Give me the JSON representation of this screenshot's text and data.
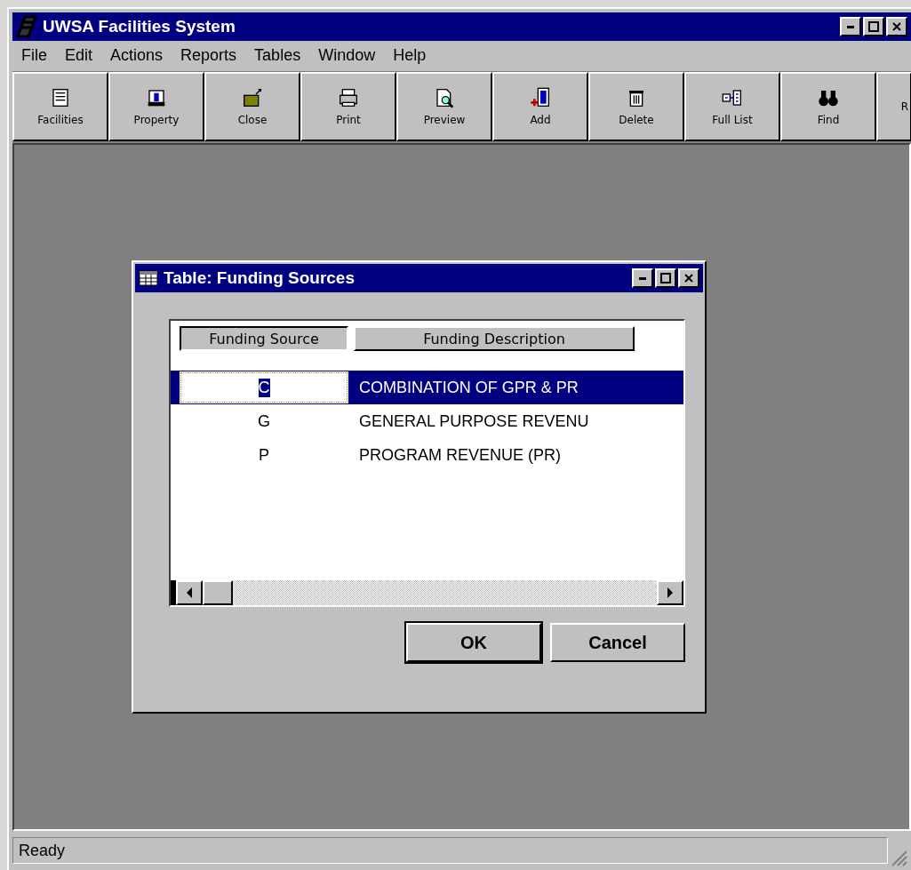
{
  "window": {
    "title": "UWSA Facilities System"
  },
  "menu": [
    "File",
    "Edit",
    "Actions",
    "Reports",
    "Tables",
    "Window",
    "Help"
  ],
  "toolbar": [
    "Facilities",
    "Property",
    "Close",
    "Print",
    "Preview",
    "Add",
    "Delete",
    "Full List",
    "Find",
    "R"
  ],
  "dialog": {
    "title": "Table: Funding Sources",
    "columns": [
      {
        "label": "Funding Source",
        "pressed": true
      },
      {
        "label": "Funding Description",
        "pressed": false
      }
    ],
    "rows": [
      {
        "code": "C",
        "description": "COMBINATION OF GPR & PR",
        "selected": true
      },
      {
        "code": "G",
        "description": "GENERAL PURPOSE REVENU",
        "selected": false
      },
      {
        "code": "P",
        "description": "PROGRAM REVENUE (PR)",
        "selected": false
      }
    ],
    "buttons": [
      "OK",
      "Cancel"
    ]
  },
  "status_bar": "Ready"
}
